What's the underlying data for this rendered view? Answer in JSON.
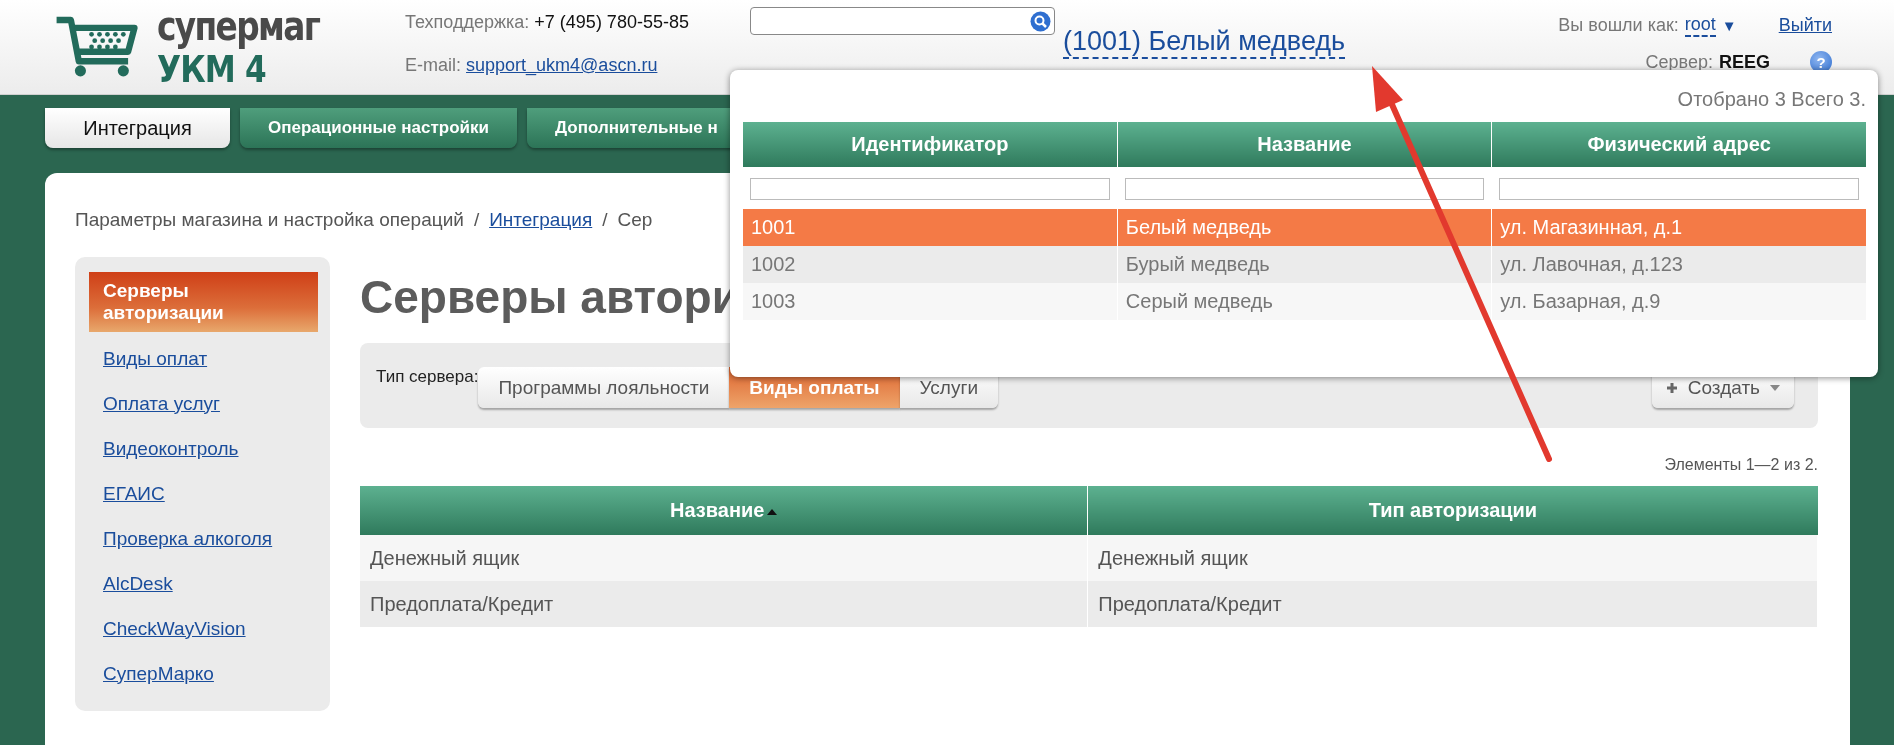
{
  "header": {
    "logo": {
      "title": "супермаг",
      "subtitle": "УКМ 4"
    },
    "support_label": "Техподдержка:",
    "support_phone": "+7 (495) 780-55-85",
    "email_label": "E-mail:",
    "email": "support_ukm4@ascn.ru",
    "store_link": "(1001) Белый медведь",
    "user_label": "Вы вошли как:",
    "user_name": "root",
    "user_caret": "▼",
    "logout": "Выйти",
    "server_label": "Сервер:",
    "server": "REEG",
    "help": "?"
  },
  "tabs": [
    {
      "label": "Интеграция",
      "selected": true
    },
    {
      "label": "Операционные настройки",
      "selected": false
    },
    {
      "label": "Дополнительные н",
      "selected": false
    }
  ],
  "breadcrumb": [
    {
      "kind": "text",
      "label": "Параметры магазина и настройка операций"
    },
    {
      "kind": "separator",
      "label": "/"
    },
    {
      "kind": "link",
      "label": "Интеграция"
    },
    {
      "kind": "separator",
      "label": "/"
    },
    {
      "kind": "text",
      "label": "Сер"
    }
  ],
  "sidebar": {
    "items": [
      {
        "label": "Серверы авторизации",
        "selected": true
      },
      {
        "label": "Виды оплат",
        "selected": false
      },
      {
        "label": "Оплата услуг",
        "selected": false
      },
      {
        "label": "Видеоконтроль",
        "selected": false
      },
      {
        "label": "ЕГАИС",
        "selected": false
      },
      {
        "label": "Проверка алкоголя",
        "selected": false
      },
      {
        "label": "AlcDesk",
        "selected": false
      },
      {
        "label": "CheckWayVision",
        "selected": false
      },
      {
        "label": "СуперМарко",
        "selected": false
      }
    ]
  },
  "page_title": "Серверы автори",
  "filter": {
    "label": "Тип сервера:",
    "options": [
      {
        "label": "Программы лояльности",
        "selected": false
      },
      {
        "label": "Виды оплаты",
        "selected": true
      },
      {
        "label": "Услуги",
        "selected": false
      }
    ],
    "create_button": "Создать"
  },
  "pager_info": "Элементы 1—2 из 2.",
  "table": {
    "columns": [
      {
        "label": "Название",
        "sorted": true
      },
      {
        "label": "Тип авторизации",
        "sorted": false
      }
    ],
    "rows": [
      [
        "Денежный ящик",
        "Денежный ящик"
      ],
      [
        "Предоплата/Кредит",
        "Предоплата/Кредит"
      ]
    ]
  },
  "store_popup": {
    "summary": "Отобрано 3 Всего 3.",
    "columns": [
      "Идентификатор",
      "Название",
      "Физический адрес"
    ],
    "rows": [
      {
        "cells": [
          "1001",
          "Белый медведь",
          "ул. Магазинная, д.1"
        ],
        "selected": true
      },
      {
        "cells": [
          "1002",
          "Бурый медведь",
          "ул. Лавочная, д.123"
        ],
        "selected": false
      },
      {
        "cells": [
          "1003",
          "Серый медведь",
          "ул. Базарная, д.9"
        ],
        "selected": false
      }
    ]
  }
}
